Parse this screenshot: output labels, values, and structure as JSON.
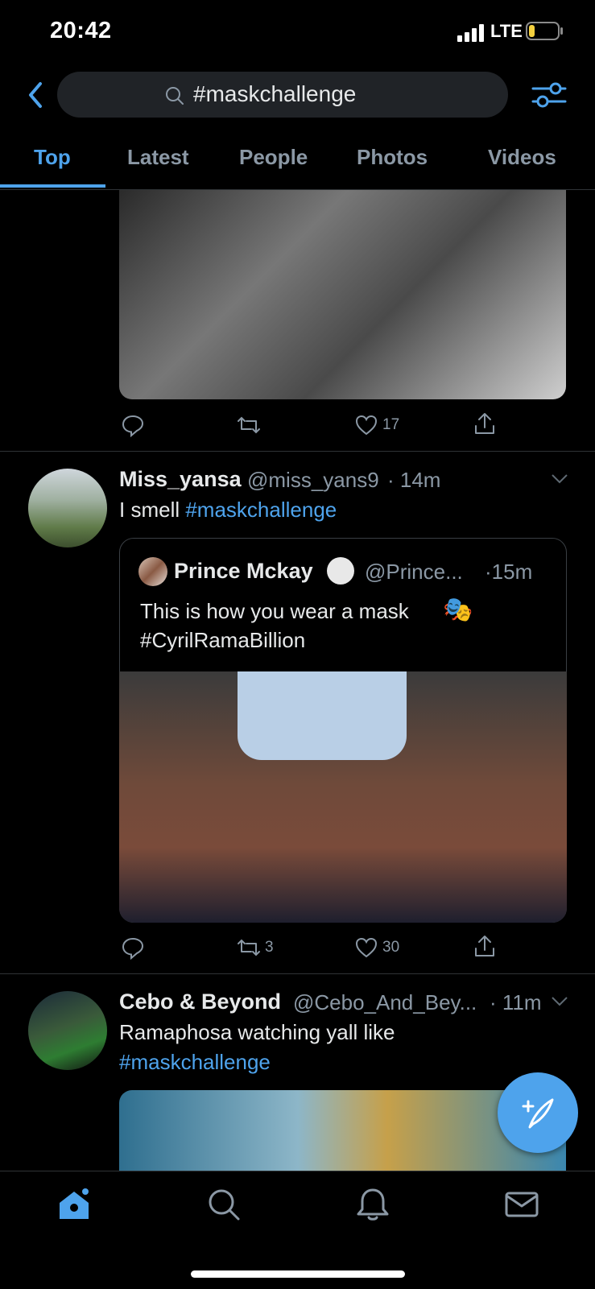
{
  "status_bar": {
    "time": "20:42",
    "network": "LTE"
  },
  "search": {
    "query": "#maskchallenge"
  },
  "tabs": [
    {
      "label": "Top",
      "active": true
    },
    {
      "label": "Latest",
      "active": false
    },
    {
      "label": "People",
      "active": false
    },
    {
      "label": "Photos",
      "active": false
    },
    {
      "label": "Videos",
      "active": false
    }
  ],
  "tweets": [
    {
      "likes": "17"
    },
    {
      "name": "Miss_yansa",
      "handle": "@miss_yans9",
      "time": "· 14m",
      "text": "I smell ",
      "hashtag": "#maskchallenge",
      "quote": {
        "name": "Prince Mckay",
        "handle": "@Prince...",
        "time": "·15m",
        "line1": "This is how you wear a mask",
        "line2": "#CyrilRamaBillion"
      },
      "retweets": "3",
      "likes": "30"
    },
    {
      "name": "Cebo & Beyond",
      "handle": "@Cebo_And_Bey...",
      "time": "· 11m",
      "text": "Ramaphosa watching yall like",
      "hashtag": "#maskchallenge"
    }
  ],
  "colors": {
    "accent": "#4ea3ec",
    "background": "#000000",
    "muted": "#8b98a5"
  }
}
